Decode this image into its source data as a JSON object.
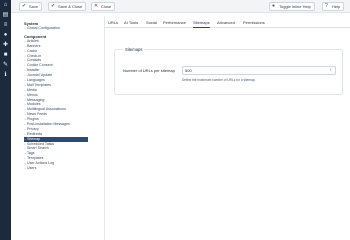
{
  "rail_icons": [
    "home-icon",
    "file-icon",
    "list-icon",
    "users-icon",
    "puzzle-icon",
    "lock-icon",
    "wrench-icon",
    "info-icon"
  ],
  "toolbar": {
    "save": "Save",
    "save_close": "Save & Close",
    "close": "Close",
    "toggle_inline_help": "Toggle Inline Help",
    "help": "Help"
  },
  "sidebar": {
    "system_heading": "System",
    "system_items": [
      "Global Configuration"
    ],
    "component_heading": "Component",
    "component_items": [
      "Articles",
      "Banners",
      "Cache",
      "Check-in",
      "Contacts",
      "Cookie Consent",
      "Installer",
      "Joomla! Update",
      "Languages",
      "Mail Templates",
      "Media",
      "Menus",
      "Messaging",
      "Modules",
      "Multilingual Associations",
      "News Feeds",
      "Plugins",
      "Post-installation Messages",
      "Privacy",
      "Redirects",
      "Sitemap",
      "Scheduled Tasks",
      "Smart Search",
      "Tags",
      "Templates",
      "User Actions Log",
      "Users"
    ],
    "active_item": "Sitemap"
  },
  "tabs": [
    "URLs",
    "AI Tools",
    "Social",
    "Performance",
    "Sitemaps",
    "Advanced",
    "Permissions"
  ],
  "active_tab": "Sitemaps",
  "form": {
    "legend": "Sitemaps",
    "urls_per_sitemap_label": "Number of URLs per sitemap",
    "urls_per_sitemap_value": "500",
    "urls_per_sitemap_desc": "Define the maximum number of URLs for a sitemap."
  },
  "colors": {
    "rail": "#1c2a3d",
    "active": "#2e4a6b"
  }
}
